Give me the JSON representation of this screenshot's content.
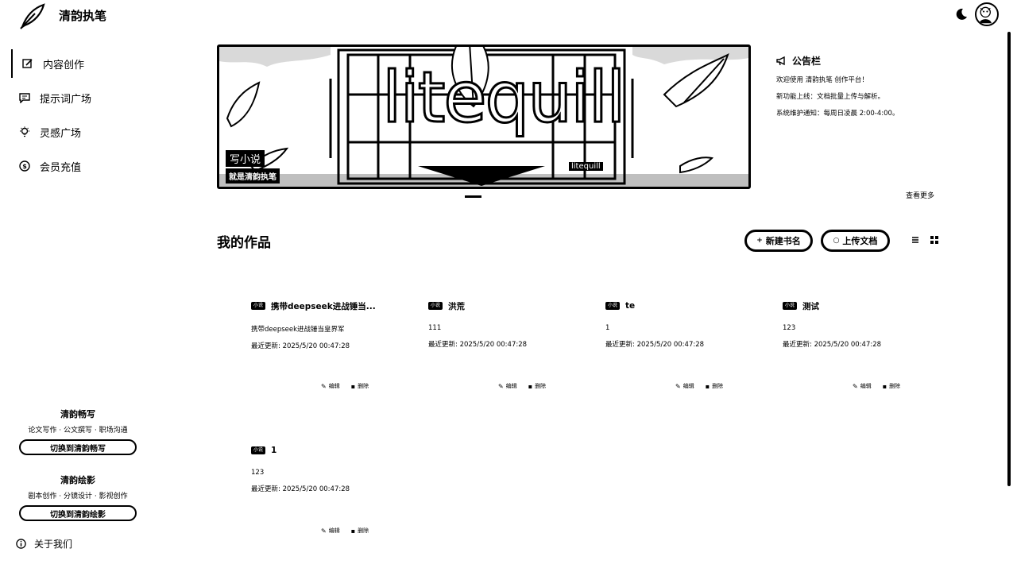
{
  "app": {
    "title": "清韵执笔"
  },
  "header": {
    "theme_icon": "moon-icon",
    "avatar_icon": "avatar"
  },
  "sidebar": {
    "items": [
      {
        "label": "内容创作",
        "icon": "edit-icon",
        "active": true
      },
      {
        "label": "提示词广场",
        "icon": "chat-icon",
        "active": false
      },
      {
        "label": "灵感广场",
        "icon": "lightbulb-icon",
        "active": false
      },
      {
        "label": "会员充值",
        "icon": "dollar-icon",
        "active": false
      }
    ],
    "promos": [
      {
        "title": "清韵畅写",
        "subtitle": "论文写作 · 公文撰写 · 职场沟通",
        "button": "切换到清韵畅写"
      },
      {
        "title": "清韵绘影",
        "subtitle": "剧本创作 · 分镜设计 · 影视创作",
        "button": "切换到清韵绘影"
      }
    ],
    "about": "关于我们"
  },
  "banner": {
    "brand": "litequill",
    "tag_main": "写小说",
    "tag_sub": "就是清韵执笔",
    "mini_tag": "litequill"
  },
  "announcement": {
    "title": "公告栏",
    "lines": [
      "欢迎使用 清韵执笔 创作平台！",
      "新功能上线：文档批量上传与解析。",
      "系统维护通知：每周日凌晨 2:00-4:00。"
    ],
    "see_more": "查看更多"
  },
  "works": {
    "title": "我的作品",
    "new_button": "新建书名",
    "upload_button": "上传文档",
    "edit_label": "编辑",
    "delete_label": "删除",
    "items": [
      {
        "badge": "小说",
        "title": "携带deepseek进战锤当...",
        "desc": "携带deepseek进战锤当皇界军",
        "updated": "最近更新: 2025/5/20 00:47:28"
      },
      {
        "badge": "小说",
        "title": "洪荒",
        "desc": "111",
        "updated": "最近更新: 2025/5/20 00:47:28"
      },
      {
        "badge": "小说",
        "title": "te",
        "desc": "1",
        "updated": "最近更新: 2025/5/20 00:47:28"
      },
      {
        "badge": "小说",
        "title": "测试",
        "desc": "123",
        "updated": "最近更新: 2025/5/20 00:47:28"
      },
      {
        "badge": "小说",
        "title": "1",
        "desc": "123",
        "updated": "最近更新: 2025/5/20 00:47:28"
      }
    ]
  }
}
